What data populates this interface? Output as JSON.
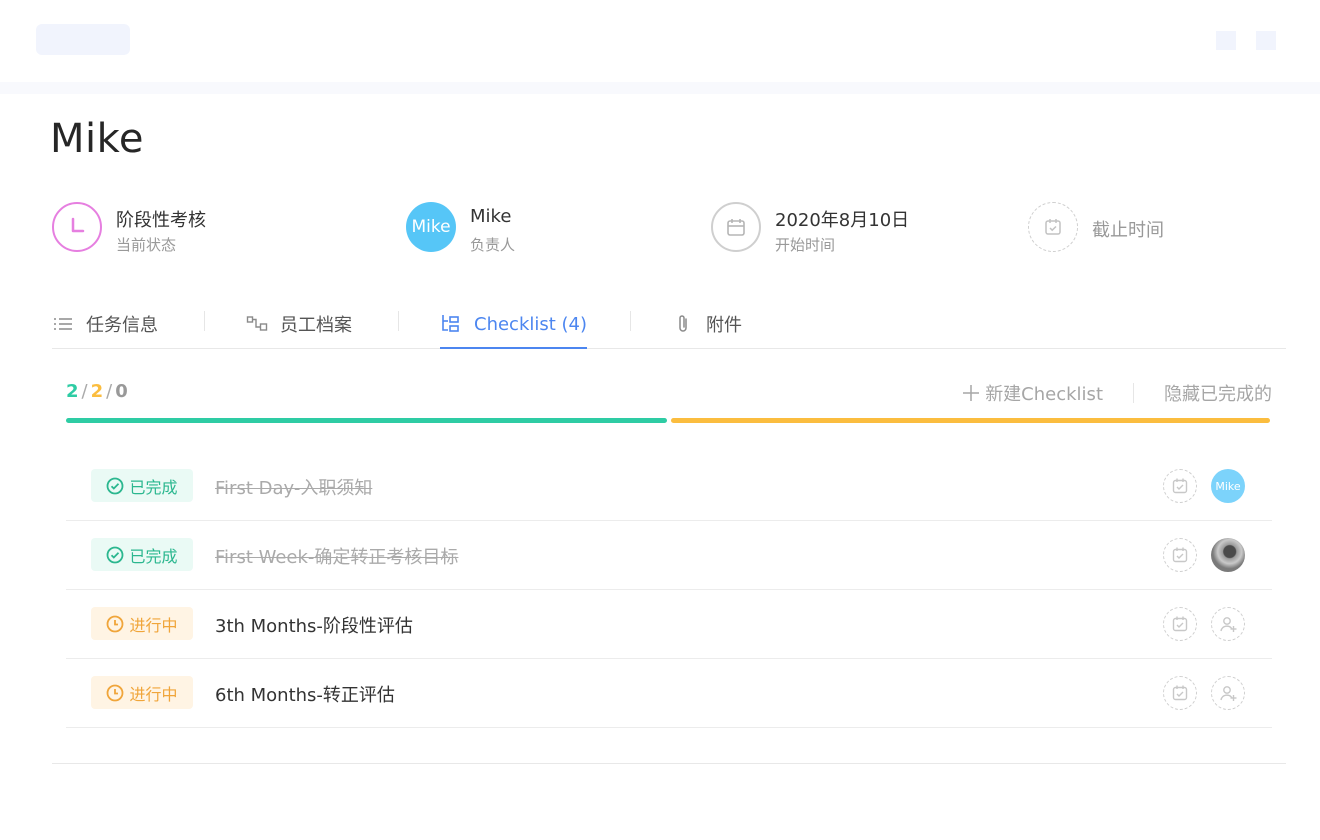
{
  "page": {
    "title": "Mike"
  },
  "info": {
    "status": {
      "value": "阶段性考核",
      "label": "当前状态"
    },
    "owner": {
      "avatar_text": "Mike",
      "value": "Mike",
      "label": "负责人"
    },
    "start": {
      "value": "2020年8月10日",
      "label": "开始时间"
    },
    "deadline": {
      "label": "截止时间"
    }
  },
  "tabs": [
    {
      "label": "任务信息",
      "icon": "list-icon"
    },
    {
      "label": "员工档案",
      "icon": "flow-icon"
    },
    {
      "label": "Checklist (4)",
      "icon": "checklist-icon",
      "active": true
    },
    {
      "label": "附件",
      "icon": "paperclip-icon"
    }
  ],
  "progress": {
    "completed": "2",
    "in_progress": "2",
    "not_started": "0",
    "separator": "/",
    "completed_fraction": 0.5,
    "in_progress_fraction": 0.5
  },
  "actions": {
    "add": "新建Checklist",
    "hide": "隐藏已完成的"
  },
  "checklist": [
    {
      "status": "已完成",
      "state": "done",
      "text": "First Day-入职须知",
      "assignee": "Mike"
    },
    {
      "status": "已完成",
      "state": "done",
      "text": "First Week-确定转正考核目标",
      "assignee": ""
    },
    {
      "status": "进行中",
      "state": "doing",
      "text": "3th Months-阶段性评估",
      "assignee": ""
    },
    {
      "status": "进行中",
      "state": "doing",
      "text": "6th Months-转正评估",
      "assignee": ""
    }
  ],
  "colors": {
    "accent": "#4c86f0",
    "done": "#2ecca4",
    "doing": "#fbbd3f",
    "status_ring": "#e67fe0",
    "owner_avatar": "#56c6f7"
  }
}
